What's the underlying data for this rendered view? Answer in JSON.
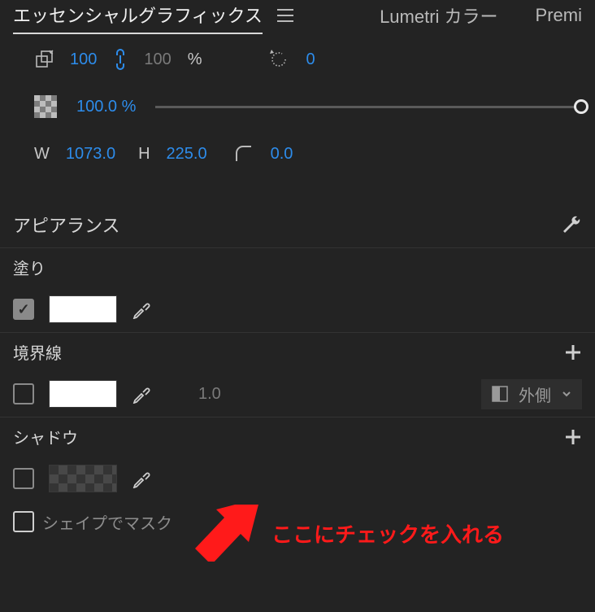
{
  "tabs": {
    "essential_graphics": "エッセンシャルグラフィックス",
    "lumetri": "Lumetri カラー",
    "premiere": "Premi"
  },
  "transform": {
    "scale": "100",
    "scale_linked": "100",
    "percent": "%",
    "rotation": "0",
    "opacity": "100.0 %",
    "w_label": "W",
    "w_value": "1073.0",
    "h_label": "H",
    "h_value": "225.0",
    "corner": "0.0"
  },
  "appearance": {
    "title": "アピアランス",
    "fill": {
      "label": "塗り"
    },
    "stroke": {
      "label": "境界線",
      "width": "1.0",
      "position": "外側"
    },
    "shadow": {
      "label": "シャドウ"
    },
    "mask_with_shape": "シェイプでマスク"
  },
  "annotation": "ここにチェックを入れる"
}
